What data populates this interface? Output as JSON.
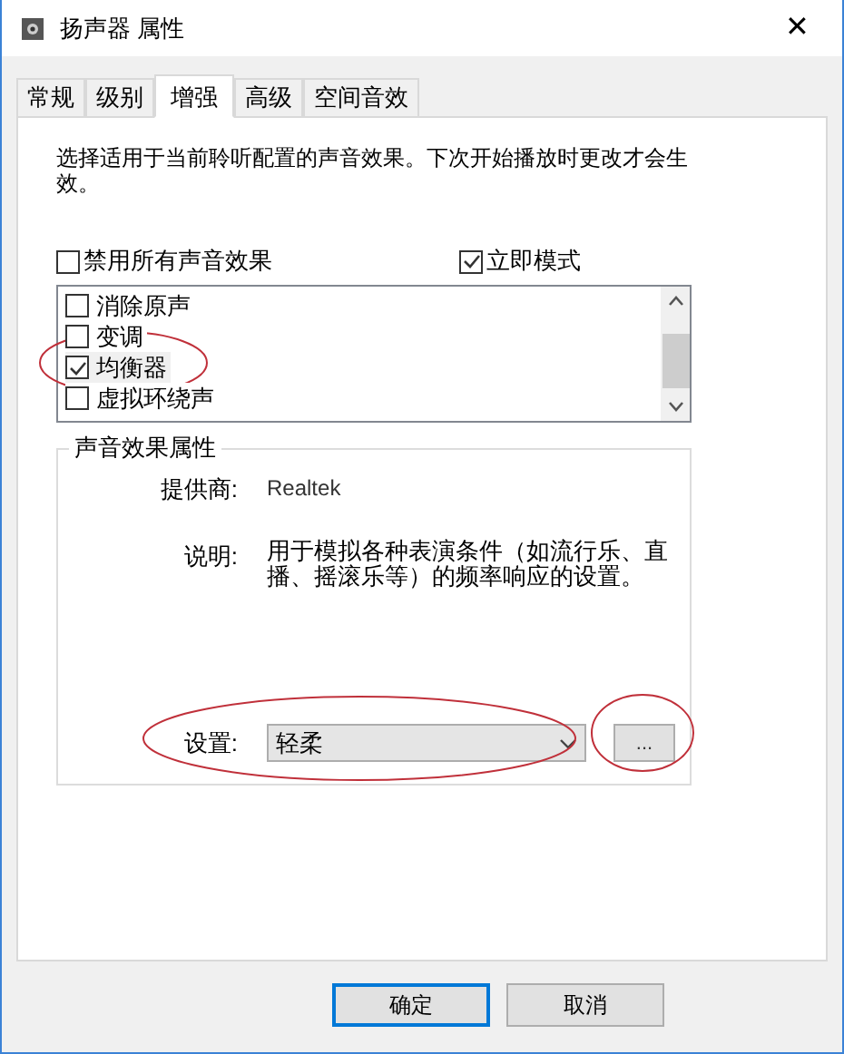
{
  "window": {
    "title": "扬声器 属性",
    "close": "✕"
  },
  "tabs": [
    {
      "label": "常规",
      "selected": false
    },
    {
      "label": "级别",
      "selected": false
    },
    {
      "label": "增强",
      "selected": true
    },
    {
      "label": "高级",
      "selected": false
    },
    {
      "label": "空间音效",
      "selected": false
    }
  ],
  "description": "选择适用于当前聆听配置的声音效果。下次开始播放时更改才会生效。",
  "options": [
    {
      "label": "禁用所有声音效果",
      "checked": false
    },
    {
      "label": "立即模式",
      "checked": true
    }
  ],
  "effects": [
    {
      "label": "消除原声",
      "checked": false,
      "selected": false
    },
    {
      "label": "变调",
      "checked": false,
      "selected": false
    },
    {
      "label": "均衡器",
      "checked": true,
      "selected": true
    },
    {
      "label": "虚拟环绕声",
      "checked": false,
      "selected": false
    }
  ],
  "properties": {
    "title": "声音效果属性",
    "provider_label": "提供商:",
    "provider": "Realtek",
    "description_label": "说明:",
    "description": "用于模拟各种表演条件（如流行乐、直播、摇滚乐等）的频率响应的设置。",
    "setting_label": "设置:",
    "setting_value": "轻柔",
    "more_button": "..."
  },
  "buttons": [
    {
      "label": "确定",
      "default": true
    },
    {
      "label": "取消",
      "default": false
    }
  ]
}
